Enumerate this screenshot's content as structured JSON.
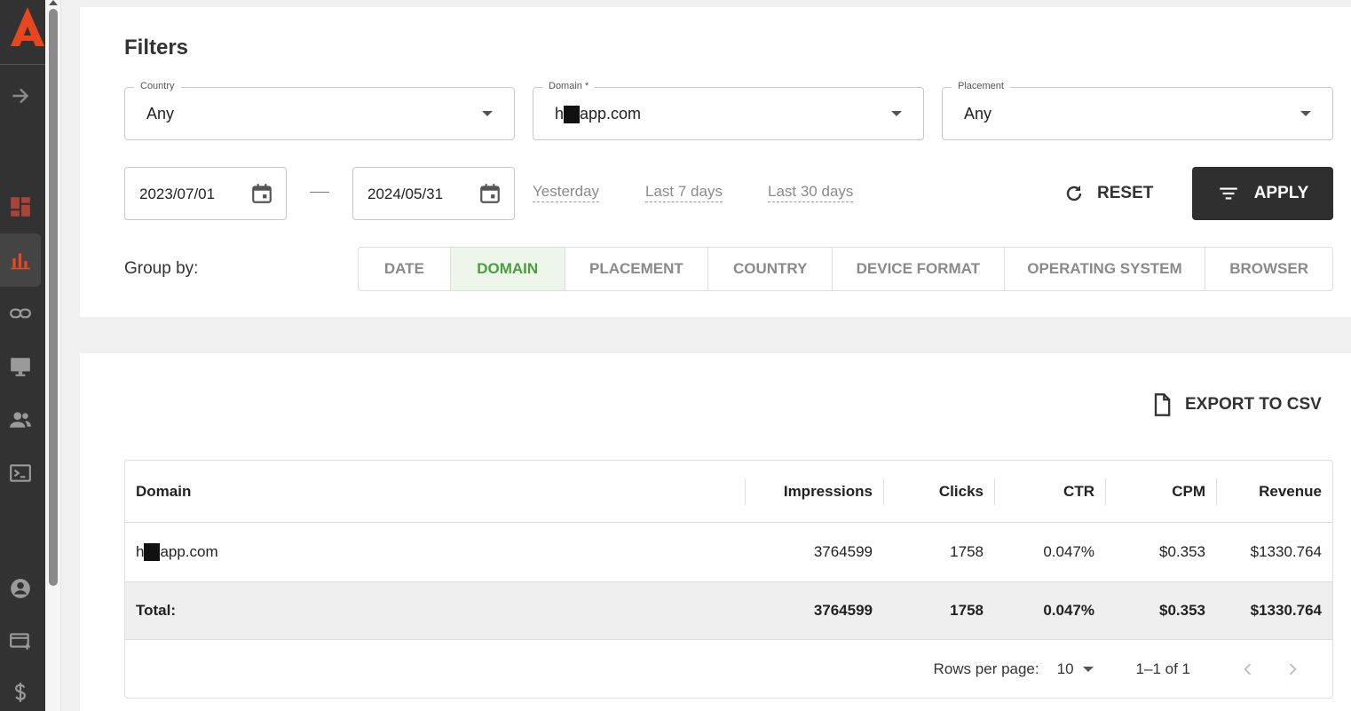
{
  "colors": {
    "sidebar": "#323232",
    "brand": "#e8461e",
    "apply_bg": "#2f2f2f",
    "active_group": "#4a9e3c"
  },
  "sidebar": {
    "icons": [
      "logo-icon",
      "expand-arrow-icon",
      "dashboard-icon",
      "bar-chart-icon",
      "link-icon",
      "monitor-icon",
      "users-icon",
      "terminal-icon",
      "account-icon",
      "add-card-icon",
      "dollar-icon"
    ]
  },
  "filters": {
    "title": "Filters",
    "country": {
      "label": "Country",
      "value": "Any"
    },
    "domain": {
      "label": "Domain *",
      "value_prefix": "h",
      "value_suffix": "app.com"
    },
    "placement": {
      "label": "Placement",
      "value": "Any"
    },
    "date_from": "2023/07/01",
    "date_to": "2024/05/31",
    "quick_links": [
      "Yesterday",
      "Last 7 days",
      "Last 30 days"
    ],
    "reset_label": "RESET",
    "apply_label": "APPLY",
    "group_by_label": "Group by:",
    "group_by_tabs": [
      "DATE",
      "DOMAIN",
      "PLACEMENT",
      "COUNTRY",
      "DEVICE FORMAT",
      "OPERATING SYSTEM",
      "BROWSER"
    ],
    "group_by_active": "DOMAIN"
  },
  "report": {
    "export_label": "EXPORT TO CSV",
    "columns": [
      "Domain",
      "Impressions",
      "Clicks",
      "CTR",
      "CPM",
      "Revenue"
    ],
    "row": {
      "domain_prefix": "h",
      "domain_suffix": "app.com",
      "impressions": "3764599",
      "clicks": "1758",
      "ctr": "0.047%",
      "cpm": "$0.353",
      "revenue": "$1330.764"
    },
    "total": {
      "label": "Total:",
      "impressions": "3764599",
      "clicks": "1758",
      "ctr": "0.047%",
      "cpm": "$0.353",
      "revenue": "$1330.764"
    },
    "pager": {
      "rows_per_page_label": "Rows per page:",
      "rows_per_page": "10",
      "range": "1–1 of 1"
    }
  }
}
